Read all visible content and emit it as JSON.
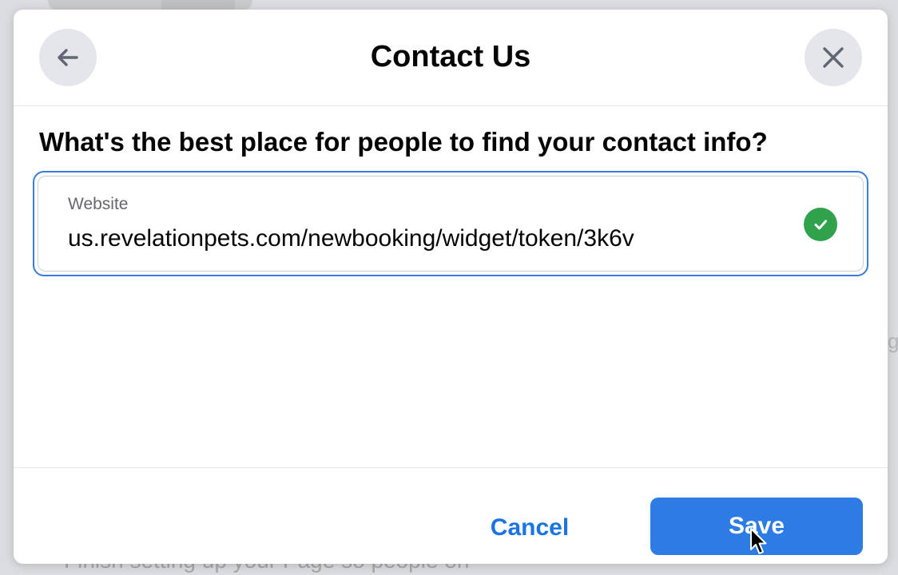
{
  "background": {
    "bottom_text": "Finish setting up your Page so people on",
    "right_glyph": "g"
  },
  "modal": {
    "title": "Contact Us",
    "back_icon": "arrow-left-icon",
    "close_icon": "close-icon",
    "question": "What's the best place for people to find your contact info?",
    "website_field": {
      "label": "Website",
      "value": "us.revelationpets.com/newbooking/widget/token/3k6v",
      "status_icon": "check-circle-icon",
      "status_color": "#31a24c"
    },
    "cancel_label": "Cancel",
    "save_label": "Save"
  },
  "colors": {
    "accent": "#2d7be4",
    "link": "#1b74e4",
    "focus_border": "#3b7ddd"
  }
}
